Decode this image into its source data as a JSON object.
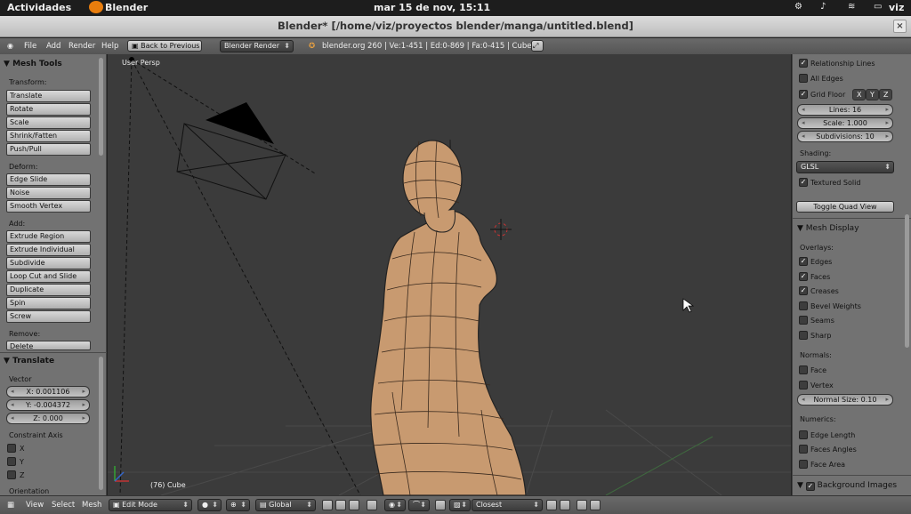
{
  "topbar": {
    "activities": "Actividades",
    "app": "Blender",
    "clock": "mar 15 de nov, 15:11",
    "user": "viz"
  },
  "window": {
    "title": "Blender* [/home/viz/proyectos blender/manga/untitled.blend]"
  },
  "menubar": {
    "menus": [
      "File",
      "Add",
      "Render",
      "Help"
    ],
    "back_button": "Back to Previous",
    "render_engine": "Blender Render",
    "status": "blender.org 260 | Ve:1-451 | Ed:0-869 | Fa:0-415 | Cube"
  },
  "left": {
    "mesh_tools_title": "Mesh Tools",
    "transform_label": "Transform:",
    "transform_buttons": [
      "Translate",
      "Rotate",
      "Scale",
      "Shrink/Fatten",
      "Push/Pull"
    ],
    "deform_label": "Deform:",
    "deform_buttons": [
      "Edge Slide",
      "Noise",
      "Smooth Vertex"
    ],
    "add_label": "Add:",
    "add_buttons": [
      "Extrude Region",
      "Extrude Individual",
      "Subdivide",
      "Loop Cut and Slide",
      "Duplicate",
      "Spin",
      "Screw"
    ],
    "remove_label": "Remove:",
    "remove_buttons": [
      "Delete"
    ],
    "translate_title": "Translate",
    "vector_label": "Vector",
    "vector": [
      "X: 0.001106",
      "Y: -0.004372",
      "Z: 0.000"
    ],
    "constraint_label": "Constraint Axis",
    "constraint_axes": [
      "X",
      "Y",
      "Z"
    ],
    "orientation_label": "Orientation"
  },
  "viewport": {
    "view_label": "User Persp",
    "object_label": "(76) Cube"
  },
  "right": {
    "relationship_lines": "Relationship Lines",
    "all_edges": "All Edges",
    "grid_floor": "Grid Floor",
    "axes": [
      "X",
      "Y",
      "Z"
    ],
    "lines": "Lines: 16",
    "scale": "Scale: 1.000",
    "subdivisions": "Subdivisions: 10",
    "shading_label": "Shading:",
    "shading_value": "GLSL",
    "textured_solid": "Textured Solid",
    "toggle_quad": "Toggle Quad View",
    "mesh_display_title": "Mesh Display",
    "overlays_label": "Overlays:",
    "overlays": [
      {
        "label": "Edges",
        "checked": true
      },
      {
        "label": "Faces",
        "checked": true
      },
      {
        "label": "Creases",
        "checked": true
      },
      {
        "label": "Bevel Weights",
        "checked": false
      },
      {
        "label": "Seams",
        "checked": false
      },
      {
        "label": "Sharp",
        "checked": false
      }
    ],
    "normals_label": "Normals:",
    "normals": [
      "Face",
      "Vertex"
    ],
    "normal_size": "Normal Size: 0.10",
    "numerics_label": "Numerics:",
    "numerics": [
      "Edge Length",
      "Faces Angles",
      "Face Area"
    ],
    "background_images": "Background Images"
  },
  "bottombar": {
    "menus": [
      "View",
      "Select",
      "Mesh"
    ],
    "mode": "Edit Mode",
    "orientation": "Global",
    "snap": "Closest"
  }
}
